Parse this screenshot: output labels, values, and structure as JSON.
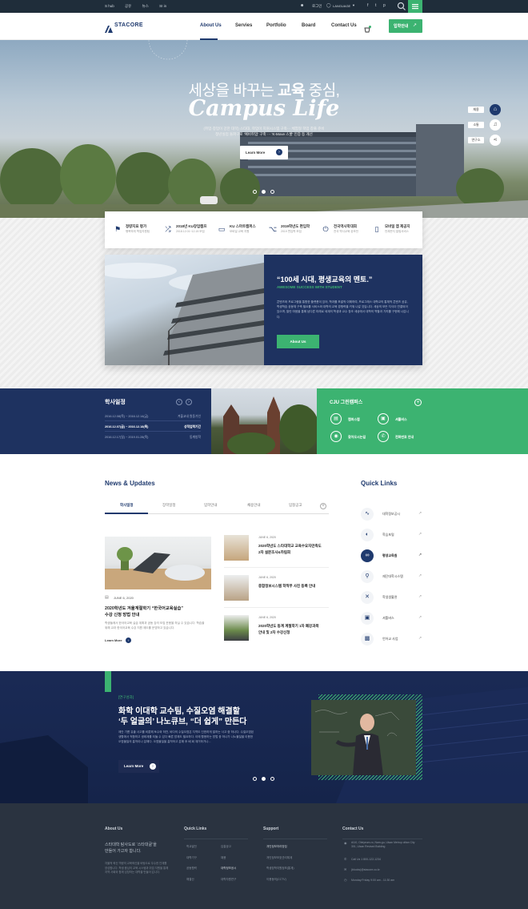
{
  "topbar": {
    "links": [
      "S hub",
      "공유",
      "뉴스",
      "SI in"
    ],
    "login": "로그인",
    "language": "LANGUAGE"
  },
  "nav": {
    "logo": "STACORE",
    "items": [
      "About Us",
      "Servies",
      "Portfolio",
      "Board",
      "Contact Us"
    ],
    "cta": "입학안내"
  },
  "hero": {
    "headline_prefix": "세상을 바꾸는 ",
    "headline_bold": "교육",
    "headline_suffix": " 중심,",
    "script": "Campus Life",
    "desc1": "(취업·창업이 강한 대학) 스타대, 학업이 지원시스템 구축··· 체험형 학업 창출 준비",
    "desc2": "청년실업 돌파구로 '예비취업' 구축 ··· 'K-Move 스쿨' 인증 등 개선",
    "button": "Learn More",
    "side": [
      "채용",
      "소통",
      "연구소"
    ]
  },
  "quick_icons": [
    {
      "title": "정량지표 평가",
      "sub": "행복하게 학업지원팀",
      "icon": "flag-icon"
    },
    {
      "title": "2018년 KU장업캠프",
      "sub": "2018.12.01~12.15 모집",
      "icon": "shuffle-icon"
    },
    {
      "title": "KU 스마트캠퍼스",
      "sub": "모바일 교육 지원",
      "icon": "folder-icon"
    },
    {
      "title": "2019학년도 편입학",
      "sub": "2019 편입학 모집",
      "icon": "merge-icon"
    },
    {
      "title": "전국역사학대회",
      "sub": "전국 역사교육 공모전",
      "icon": "power-icon"
    },
    {
      "title": "모바일 앱 제공지",
      "sub": "언제든지 알림서비스",
      "icon": "mobile-icon"
    }
  ],
  "promo": {
    "title": "“100세 시대, 평생교육의 멘토.”",
    "subtitle": "AWESOME SUCCESS WITH STUDENT",
    "body": "콘텐츠와 프로그램을 통합한 플랫폼이 있어, 학과를 포괄적 이해하여, 프로그래스 대학교의 통체적 콘텐츠 공유, 학생학습 공동체 구축 필요를 서비스와 대학의 교육 경쟁력을 키워 나갈 것입니다. 세상의 모든 지식이 연결되어 있으며, 열린 마음을 통해 남다른 미래로 세계의 학생과 교수 창조 세상에서 대학의 역할과 가치를 구현해 나갑니다.",
    "button": "About Us"
  },
  "schedule": {
    "title": "학사일정",
    "rows": [
      {
        "date": "2016.12.08(목) ~ 2016.12.14(금)",
        "event": "겨울교내 원동가인"
      },
      {
        "date": "2016.12.07(금) ~ 2016.12.18(목)",
        "event": "성적업력기간"
      },
      {
        "date": "2016.12.17(일) ~ 2019.01.28(목)",
        "event": "동계방학"
      }
    ]
  },
  "green_campus": {
    "title": "CJU 그린캠퍼스",
    "items": [
      "캠퍼스맵",
      "셔틀버스",
      "찾아오시는길",
      "전화번호 안내"
    ]
  },
  "news": {
    "title": "News & Updates",
    "tabs": [
      "학사일정",
      "장학일정",
      "입학안내",
      "채용안내",
      "입찰공고"
    ],
    "feature": {
      "date": "JUNE 6, 2020",
      "title1": "2020학년도 겨울계절학기 “한국어교육실습”",
      "title2": "수강 신청 방법 안내",
      "desc": "학생들께서 한국어교육 실습 계획과 공동 강의 모집 운용을 하실 수 있습니다. 학습을 위해 교과 한국어교육 수강 지원 제도를 운영하고 있습니다.",
      "link": "Learn More"
    },
    "list": [
      {
        "date": "JUNE 6, 2020",
        "title1": "2020학년도 스타대학교 교육수요자만족도",
        "title2": "2차 설문조사&하림회"
      },
      {
        "date": "JUNE 6, 2020",
        "title1": "종합정보시스템 학적부 사진 등록 안내",
        "title2": ""
      },
      {
        "date": "JUNE 6, 2020",
        "title1": "2020학년도 동계 계절학기 1차 폐강과목",
        "title2": "안내 및 2차 수강신청"
      }
    ]
  },
  "quick_links": {
    "title": "Quick Links",
    "items": [
      {
        "label": "대학정보공시",
        "icon": "chart-icon"
      },
      {
        "label": "학습포털",
        "icon": "bulb-icon"
      },
      {
        "label": "평생교육원",
        "icon": "link-icon"
      },
      {
        "label": "재단대학시스템",
        "icon": "search-icon"
      },
      {
        "label": "학생생활관",
        "icon": "tools-icon"
      },
      {
        "label": "셔틀버스",
        "icon": "bus-icon"
      },
      {
        "label": "언어교 사업",
        "icon": "box-icon"
      }
    ]
  },
  "research": {
    "tag": "[연구성과]",
    "title1": "화학 이대학 교수팀, 수질오염 해결할",
    "title2": "‘두 얼굴의’ 나노큐브, “더 쉽게” 만든다",
    "desc": "제안 기름 유출 사고를 비롯해 토수와 하천, 바다의 수질오염은 지역도 인한하게 발하는 사고 중 하나다. 수질오염된 생활에서 적합하고 생태계를 되돌 수 있다 빠른 방제도 필요하다. 이에 활용하는 방법 중 하나가 나노물질을 이용한 오염물질의 흡착이나 분해다. 오염물질을 흡착하고 분해 후 배 회 재거하거나...",
    "button": "Learn More"
  },
  "footer": {
    "about": {
      "title": "About Us",
      "slogan1": "스타대학 탐사도로 ‘스타대굴’을",
      "slogan2": "만들어 가고자 합니다.",
      "body": "자율적 혁신 역량의 교육혁신을 바탕으로 우수한 인재를 양성합니다. 학생 중심의 교육 시스템과 취업 지원을 통해 지역 사회와 함께 성장하는 대학을 만들어 갑니다."
    },
    "quick": {
      "title": "Quick Links",
      "items": [
        "학교발전",
        "입찰공고",
        "대학기구",
        "채용",
        "공동협력",
        "대학정보공시",
        "예결산",
        "대학자원연구"
      ]
    },
    "support": {
      "title": "Support",
      "items": [
        "개인정보처리방침",
        "개인정보보호관리체계",
        "학생장학지원정보(통계)",
        "이용동의(CCTV)"
      ]
    },
    "contact": {
      "title": "Contact Us",
      "items": [
        "#110, Oleiyeum-ro, Nam-gu, Ulsan Metrop olitan City 301, Ulsan Revised Building",
        "Call Us 1 800-122-1234",
        "(blocks)@stacore.co.kr",
        "Monday Friday 9:00 am - 11:30 am"
      ]
    }
  }
}
